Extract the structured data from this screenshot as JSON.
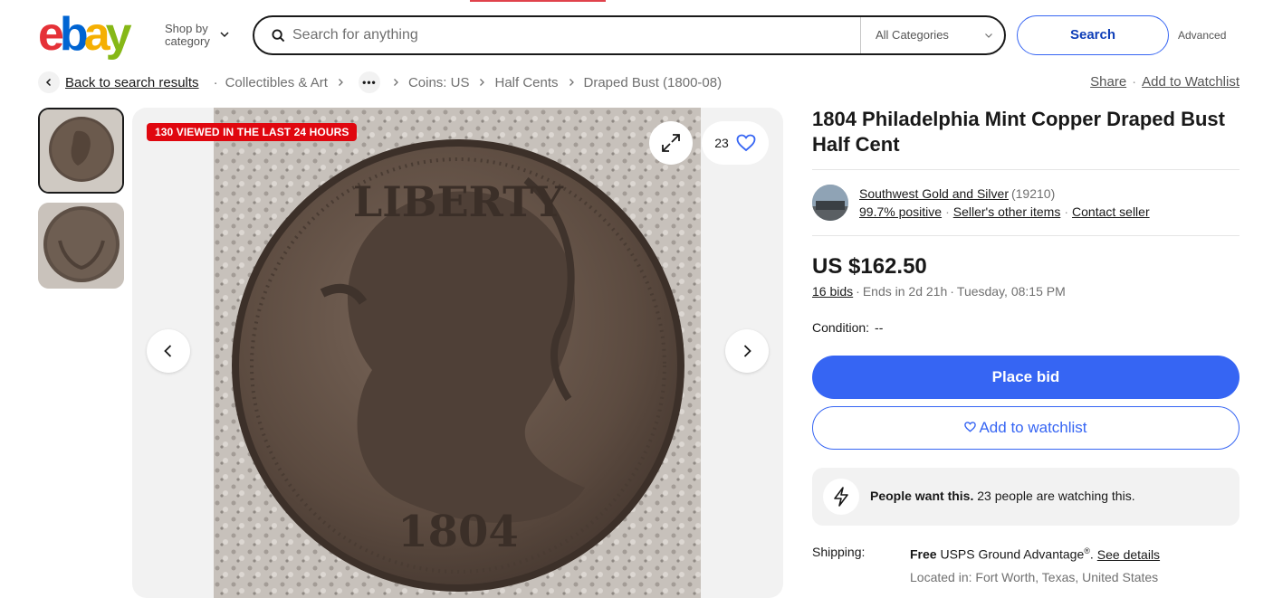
{
  "header": {
    "logo": {
      "letters": [
        "e",
        "b",
        "a",
        "y"
      ],
      "colors": [
        "#e53238",
        "#0064d2",
        "#f5af02",
        "#86b817"
      ]
    },
    "shop_by_line1": "Shop by",
    "shop_by_line2": "category",
    "search_placeholder": "Search for anything",
    "category_select": "All Categories",
    "search_button": "Search",
    "advanced": "Advanced"
  },
  "breadcrumb": {
    "back": "Back to search results",
    "items": [
      "Collectibles & Art",
      "Coins: US",
      "Half Cents",
      "Draped Bust (1800-08)"
    ],
    "more": "•••"
  },
  "actions": {
    "share": "Share",
    "watchlist": "Add to Watchlist"
  },
  "gallery": {
    "viewed_badge": "130 VIEWED IN THE LAST 24 HOURS",
    "watch_count": "23",
    "coin_obverse_legend": "LIBERTY",
    "coin_obverse_date": "1804",
    "thumbnail_count": 2,
    "selected_thumbnail": 1
  },
  "item": {
    "title": "1804 Philadelphia Mint Copper Draped Bust Half Cent",
    "seller": {
      "name": "Southwest Gold and Silver",
      "feedback_count": "(19210)",
      "positive": "99.7% positive",
      "other_items": "Seller's other items",
      "contact": "Contact seller"
    },
    "price": "US $162.50",
    "bids": "16 bids",
    "ends": "Ends in 2d 21h",
    "end_time": "Tuesday, 08:15 PM",
    "condition_label": "Condition:",
    "condition_value": "--",
    "place_bid": "Place bid",
    "add_to_watchlist": "Add to watchlist",
    "people_bold": "People want this.",
    "people_rest": " 23 people are watching this.",
    "shipping_label": "Shipping:",
    "shipping_free": "Free",
    "shipping_service": " USPS Ground Advantage",
    "shipping_reg": "®",
    "shipping_period": ".",
    "see_details": "See details",
    "located": "Located in: Fort Worth, Texas, United States"
  },
  "colors": {
    "primary_blue": "#3665f3",
    "badge_red": "#e0070f",
    "text": "#191919",
    "muted": "#707070"
  }
}
